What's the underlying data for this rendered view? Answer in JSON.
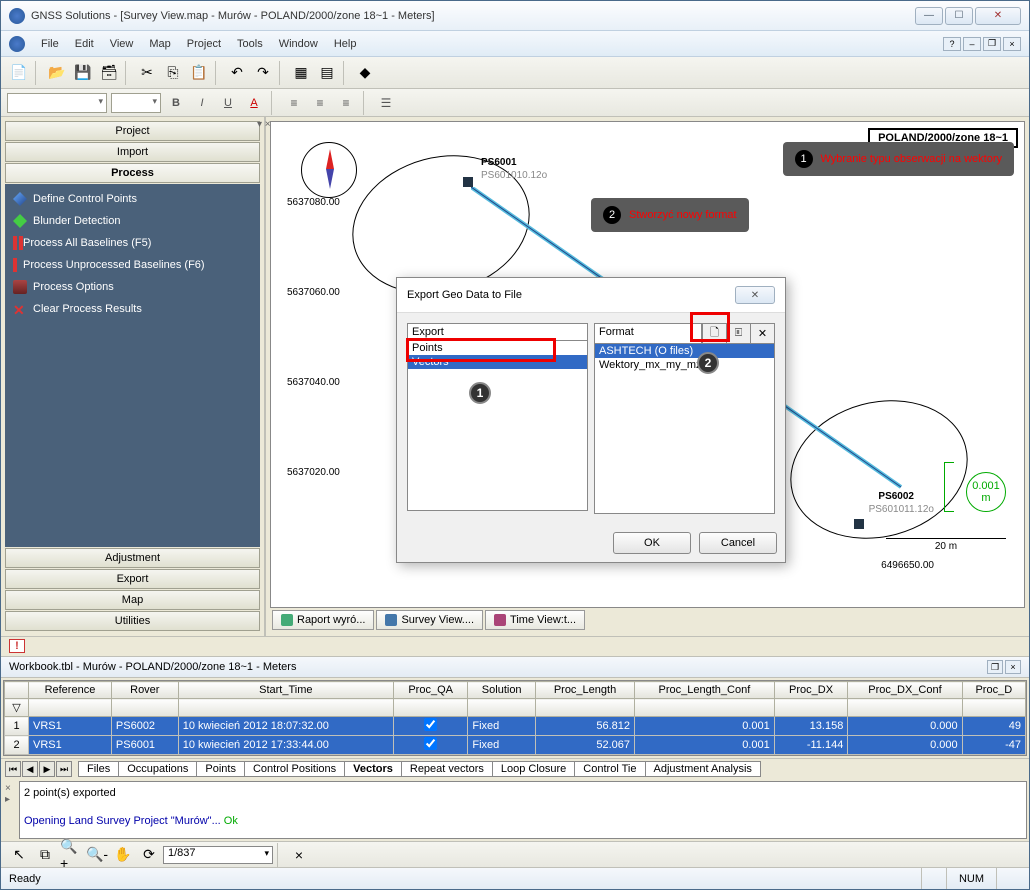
{
  "window_title": "GNSS Solutions - [Survey View.map - Murów - POLAND/2000/zone 18~1 - Meters]",
  "menu": {
    "file": "File",
    "edit": "Edit",
    "view": "View",
    "map": "Map",
    "project": "Project",
    "tools": "Tools",
    "window": "Window",
    "help": "Help"
  },
  "sidebar": {
    "project": "Project",
    "import": "Import",
    "process": "Process",
    "adjustment": "Adjustment",
    "export": "Export",
    "map": "Map",
    "utilities": "Utilities",
    "items": [
      {
        "label": "Define Control Points"
      },
      {
        "label": "Blunder Detection"
      },
      {
        "label": "Process All Baselines (F5)"
      },
      {
        "label": "Process Unprocessed Baselines (F6)"
      },
      {
        "label": "Process Options"
      },
      {
        "label": "Clear Process Results"
      }
    ]
  },
  "map": {
    "title": "POLAND/2000/zone 18~1",
    "coords": [
      "5637080.00",
      "5637060.00",
      "5637040.00",
      "5637020.00"
    ],
    "bottom_coord": "6496650.00",
    "p1": "PS6001",
    "p1file": "PS601010.12o",
    "p2": "PS6002",
    "p2file": "PS601011.12o",
    "scale_val": "0.001",
    "scale_unit": "m",
    "scale_bar": "20 m"
  },
  "callouts": {
    "c1": "Wybranie typu obserwacji na wektory",
    "c2": "Stworzyć nowy format"
  },
  "dialog": {
    "title": "Export Geo Data to File",
    "col1": "Export",
    "col2": "Format",
    "list1": [
      "Points",
      "Vectors"
    ],
    "list2": [
      "ASHTECH (O files)",
      "Wektory_mx_my_mz"
    ],
    "ok": "OK",
    "cancel": "Cancel"
  },
  "doc_tabs": {
    "t1": "Raport wyró...",
    "t2": "Survey View....",
    "t3": "Time View:t..."
  },
  "workbook": {
    "title": "Workbook.tbl - Murów - POLAND/2000/zone 18~1 - Meters",
    "cols": [
      "",
      "Reference",
      "Rover",
      "Start_Time",
      "Proc_QA",
      "Solution",
      "Proc_Length",
      "Proc_Length_Conf",
      "Proc_DX",
      "Proc_DX_Conf",
      "Proc_D"
    ],
    "rows": [
      {
        "n": "1",
        "ref": "VRS1",
        "rov": "PS6002",
        "time": "10 kwiecień 2012 18:07:32.00",
        "qa": "✓",
        "sol": "Fixed",
        "len": "56.812",
        "lenc": "0.001",
        "dx": "13.158",
        "dxc": "0.000",
        "pd": "49"
      },
      {
        "n": "2",
        "ref": "VRS1",
        "rov": "PS6001",
        "time": "10 kwiecień 2012 17:33:44.00",
        "qa": "✓",
        "sol": "Fixed",
        "len": "52.067",
        "lenc": "0.001",
        "dx": "-11.144",
        "dxc": "0.000",
        "pd": "-47"
      }
    ],
    "tabs": [
      "Files",
      "Occupations",
      "Points",
      "Control Positions",
      "Vectors",
      "Repeat vectors",
      "Loop Closure",
      "Control Tie",
      "Adjustment Analysis"
    ]
  },
  "log": {
    "l1": "2 point(s) exported",
    "l2a": "Opening Land Survey Project \"Murów\"... ",
    "l2b": "Ok"
  },
  "zoom": "1/837",
  "status": {
    "ready": "Ready",
    "num": "NUM"
  }
}
